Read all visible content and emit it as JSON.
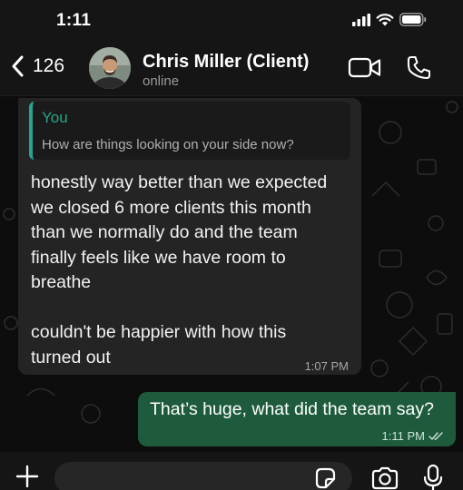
{
  "status_bar": {
    "time": "1:11",
    "icons": [
      "signal-icon",
      "wifi-icon",
      "battery-icon"
    ]
  },
  "header": {
    "back_icon": "chevron-left-icon",
    "back_count": "126",
    "contact_name": "Chris Miller (Client)",
    "contact_status": "online",
    "video_icon": "video-camera-icon",
    "call_icon": "phone-icon"
  },
  "messages": {
    "incoming": {
      "quote_author": "You",
      "quote_text": "How are things looking on your side now?",
      "lines": [
        "honestly way better than we expected",
        "we closed 6 more clients this month",
        "than we normally do and the team",
        "finally feels like we have room to",
        "breathe"
      ],
      "lines_2": [
        "couldn't be happier with how this",
        "turned out"
      ],
      "time": "1:07 PM"
    },
    "outgoing": {
      "text": "That’s huge, what did the team say?",
      "time": "1:11 PM",
      "status_icon": "double-check-icon"
    }
  },
  "input_bar": {
    "placeholder": "",
    "icons": [
      "plus-icon",
      "sticker-icon",
      "camera-icon",
      "microphone-icon"
    ]
  },
  "colors": {
    "accent": "#26a58a",
    "outgoing_bubble": "#1e5b3c",
    "incoming_bubble": "#242424",
    "background": "#0d0d0d"
  }
}
